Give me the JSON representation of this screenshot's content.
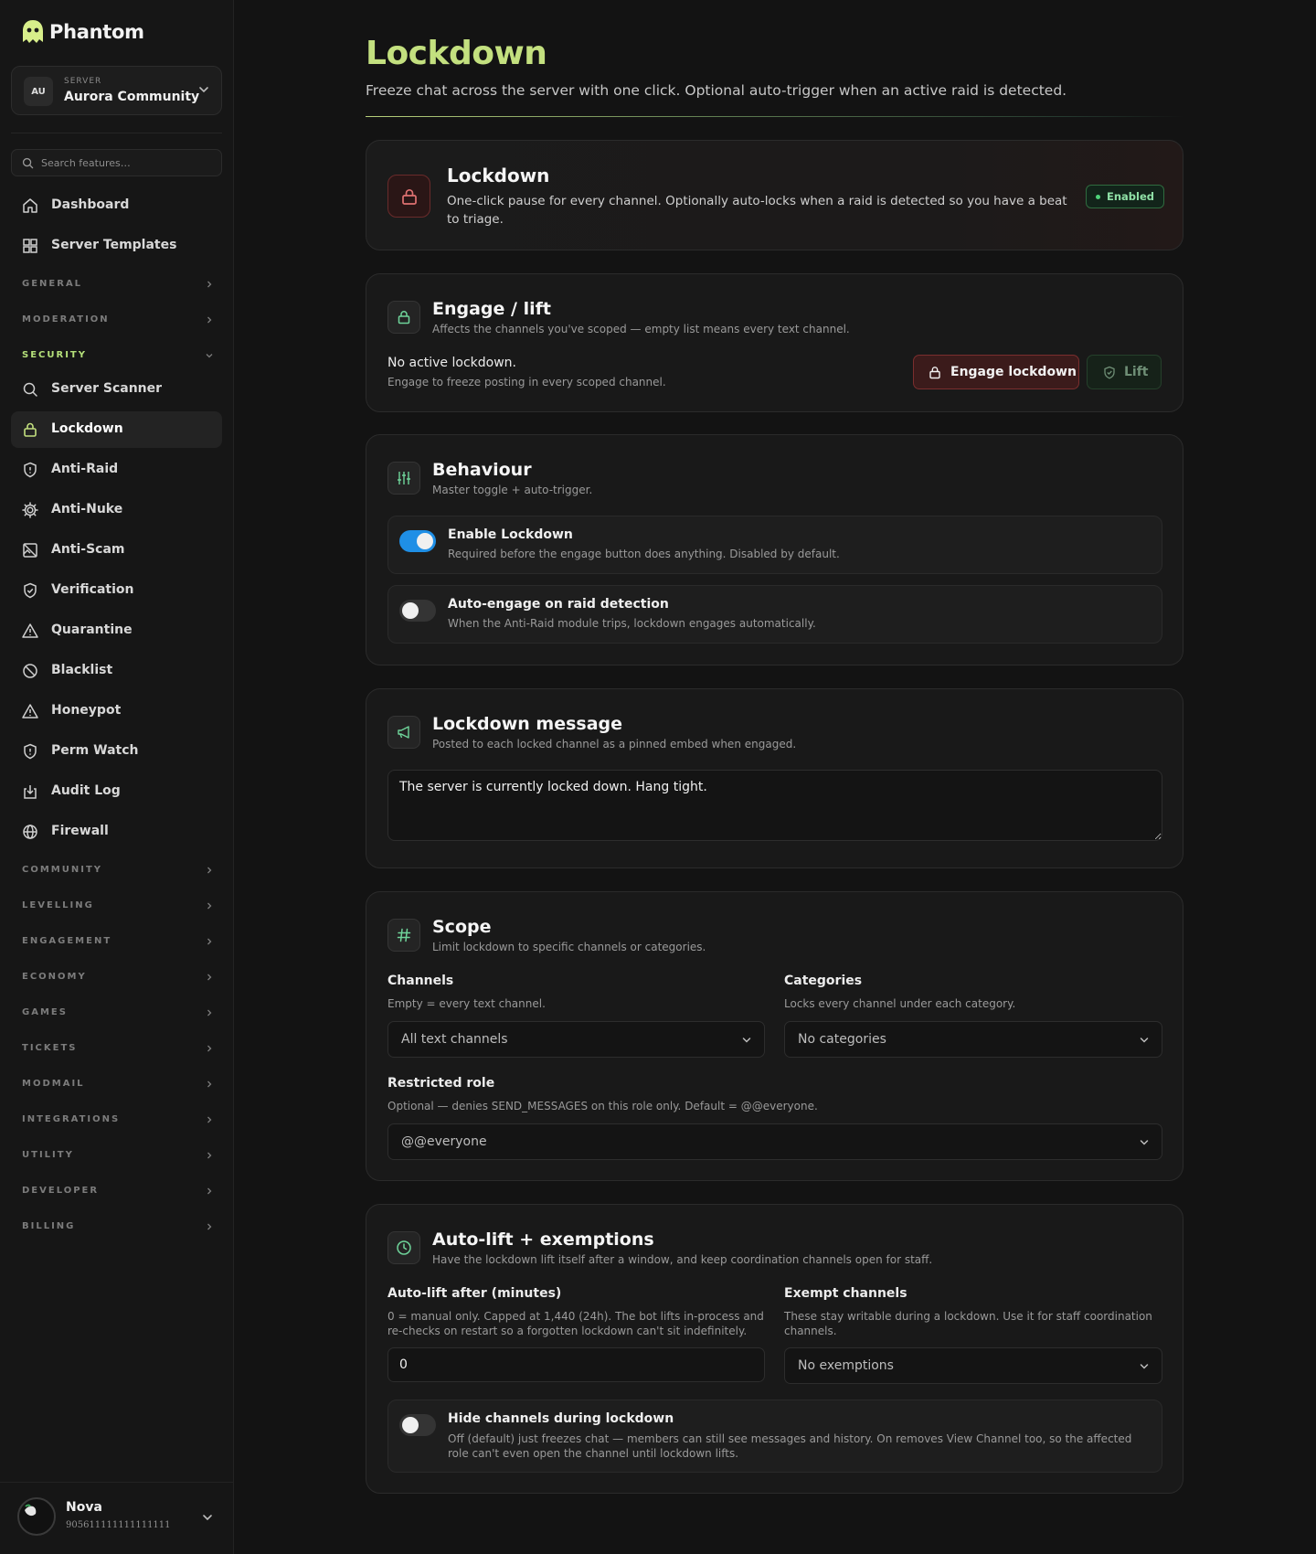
{
  "brand": {
    "name": "Phantom"
  },
  "server": {
    "avatar_initials": "AU",
    "caption": "SERVER",
    "name": "Aurora Community"
  },
  "search": {
    "placeholder": "Search features…"
  },
  "nav_top": [
    {
      "label": "Dashboard",
      "icon": "home-icon"
    },
    {
      "label": "Server Templates",
      "icon": "grid-icon"
    }
  ],
  "sections_collapsed_top": [
    {
      "label": "GENERAL"
    },
    {
      "label": "MODERATION"
    }
  ],
  "security": {
    "label": "SECURITY",
    "items": [
      {
        "label": "Server Scanner",
        "icon": "search-icon"
      },
      {
        "label": "Lockdown",
        "icon": "lock-icon"
      },
      {
        "label": "Anti-Raid",
        "icon": "shield-alert-icon"
      },
      {
        "label": "Anti-Nuke",
        "icon": "gear-icon"
      },
      {
        "label": "Anti-Scam",
        "icon": "image-off-icon"
      },
      {
        "label": "Verification",
        "icon": "shield-check-icon"
      },
      {
        "label": "Quarantine",
        "icon": "warning-icon"
      },
      {
        "label": "Blacklist",
        "icon": "ban-icon"
      },
      {
        "label": "Honeypot",
        "icon": "warning-icon"
      },
      {
        "label": "Perm Watch",
        "icon": "shield-alert-icon"
      },
      {
        "label": "Audit Log",
        "icon": "download-box-icon"
      },
      {
        "label": "Firewall",
        "icon": "globe-icon"
      }
    ]
  },
  "sections_collapsed_bottom": [
    {
      "label": "COMMUNITY"
    },
    {
      "label": "LEVELLING"
    },
    {
      "label": "ENGAGEMENT"
    },
    {
      "label": "ECONOMY"
    },
    {
      "label": "GAMES"
    },
    {
      "label": "TICKETS"
    },
    {
      "label": "MODMAIL"
    },
    {
      "label": "INTEGRATIONS"
    },
    {
      "label": "UTILITY"
    },
    {
      "label": "DEVELOPER"
    },
    {
      "label": "BILLING"
    }
  ],
  "user": {
    "name": "Nova",
    "id": "905611111111111111"
  },
  "page": {
    "title": "Lockdown",
    "subtitle": "Freeze chat across the server with one click. Optional auto-trigger when an active raid is detected."
  },
  "hero": {
    "title": "Lockdown",
    "description": "One-click pause for every channel. Optionally auto-locks when a raid is detected so you have a beat to triage.",
    "badge": "Enabled"
  },
  "engage": {
    "title": "Engage / lift",
    "subtitle": "Affects the channels you've scoped — empty list means every text channel.",
    "status_title": "No active lockdown.",
    "status_sub": "Engage to freeze posting in every scoped channel.",
    "engage_label": "Engage lockdown",
    "lift_label": "Lift"
  },
  "behaviour": {
    "title": "Behaviour",
    "subtitle": "Master toggle + auto-trigger.",
    "toggles": [
      {
        "title": "Enable Lockdown",
        "desc": "Required before the engage button does anything. Disabled by default.",
        "on": true
      },
      {
        "title": "Auto-engage on raid detection",
        "desc": "When the Anti-Raid module trips, lockdown engages automatically.",
        "on": false
      }
    ]
  },
  "message": {
    "title": "Lockdown message",
    "subtitle": "Posted to each locked channel as a pinned embed when engaged.",
    "value": "The server is currently locked down. Hang tight."
  },
  "scope": {
    "title": "Scope",
    "subtitle": "Limit lockdown to specific channels or categories.",
    "channels_label": "Channels",
    "channels_help": "Empty = every text channel.",
    "channels_value": "All text channels",
    "categories_label": "Categories",
    "categories_help": "Locks every channel under each category.",
    "categories_value": "No categories",
    "role_label": "Restricted role",
    "role_help": "Optional — denies SEND_MESSAGES on this role only. Default = @@everyone.",
    "role_value": "@@everyone"
  },
  "autolift": {
    "title": "Auto-lift + exemptions",
    "subtitle": "Have the lockdown lift itself after a window, and keep coordination channels open for staff.",
    "minutes_label": "Auto-lift after (minutes)",
    "minutes_help": "0 = manual only. Capped at 1,440 (24h). The bot lifts in-process and re-checks on restart so a forgotten lockdown can't sit indefinitely.",
    "minutes_value": "0",
    "exempt_label": "Exempt channels",
    "exempt_help": "These stay writable during a lockdown. Use it for staff coordination channels.",
    "exempt_value": "No exemptions",
    "hide_title": "Hide channels during lockdown",
    "hide_desc": "Off (default) just freezes chat — members can still see messages and history. On removes View Channel too, so the affected role can't even open the channel until lockdown lifts.",
    "hide_on": false
  },
  "colors": {
    "accent_green": "#c3e07f",
    "toggle_on": "#1f8fe6",
    "danger": "#7a2e2e",
    "success": "#4fd27a"
  }
}
